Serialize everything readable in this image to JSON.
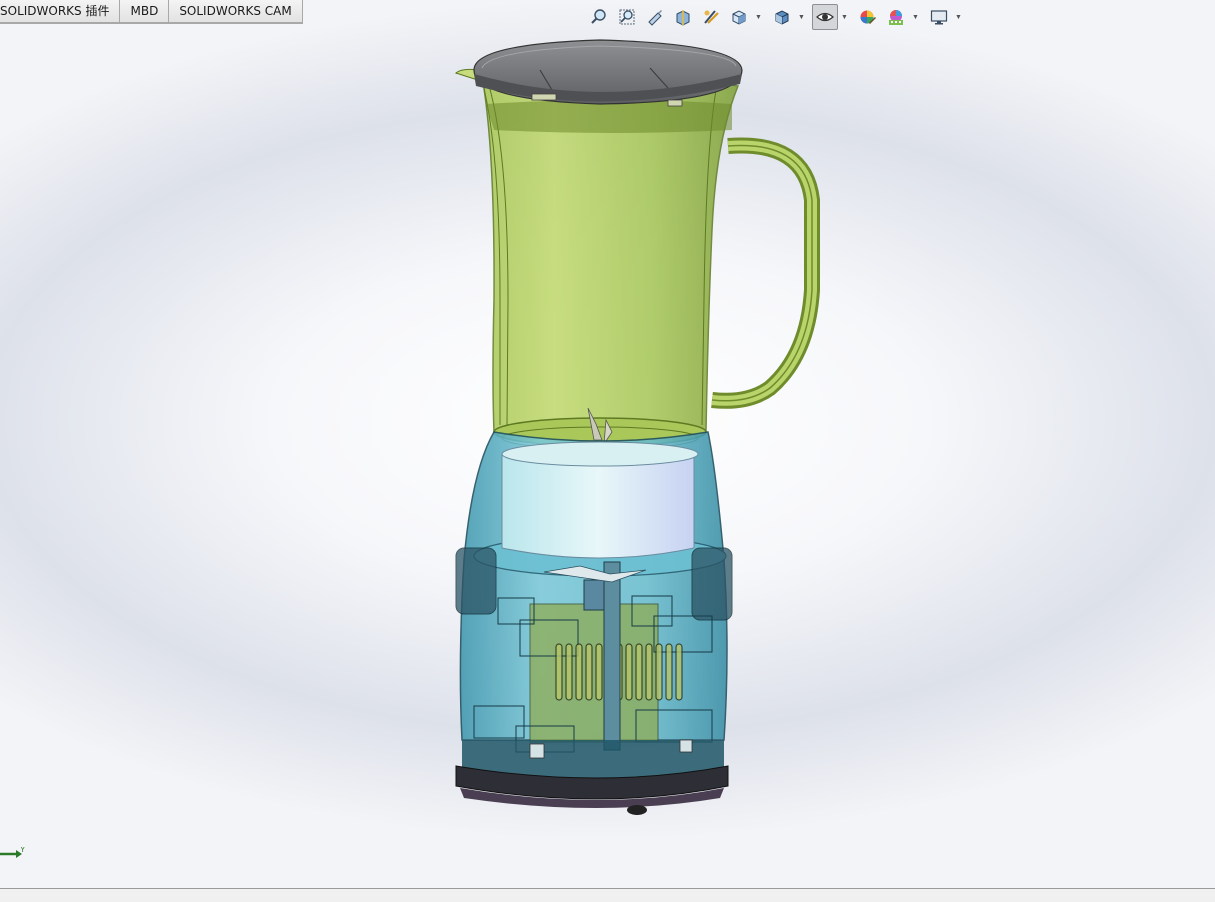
{
  "command_manager": {
    "tabs": [
      {
        "label": "SOLIDWORKS 插件"
      },
      {
        "label": "MBD"
      },
      {
        "label": "SOLIDWORKS CAM"
      }
    ]
  },
  "heads_up_toolbar": {
    "buttons": [
      {
        "icon": "zoom-to-fit-icon"
      },
      {
        "icon": "zoom-to-area-icon"
      },
      {
        "icon": "previous-view-icon"
      },
      {
        "icon": "section-view-icon"
      },
      {
        "icon": "dynamic-annotation-views-icon"
      },
      {
        "icon": "view-orientation-icon"
      },
      {
        "icon": "display-style-icon"
      },
      {
        "icon": "hide-show-items-icon",
        "active": true
      },
      {
        "icon": "edit-appearance-icon"
      },
      {
        "icon": "apply-scene-icon"
      },
      {
        "icon": "view-settings-icon"
      }
    ]
  },
  "triad": {
    "axis_label": "Y"
  },
  "colors": {
    "jar_green": "#a6c84a",
    "lid_gray": "#7b7d80",
    "base_blue": "#5fb8c9",
    "base_ring": "#2e2f36",
    "toolbar_active": "#d4d6da"
  }
}
